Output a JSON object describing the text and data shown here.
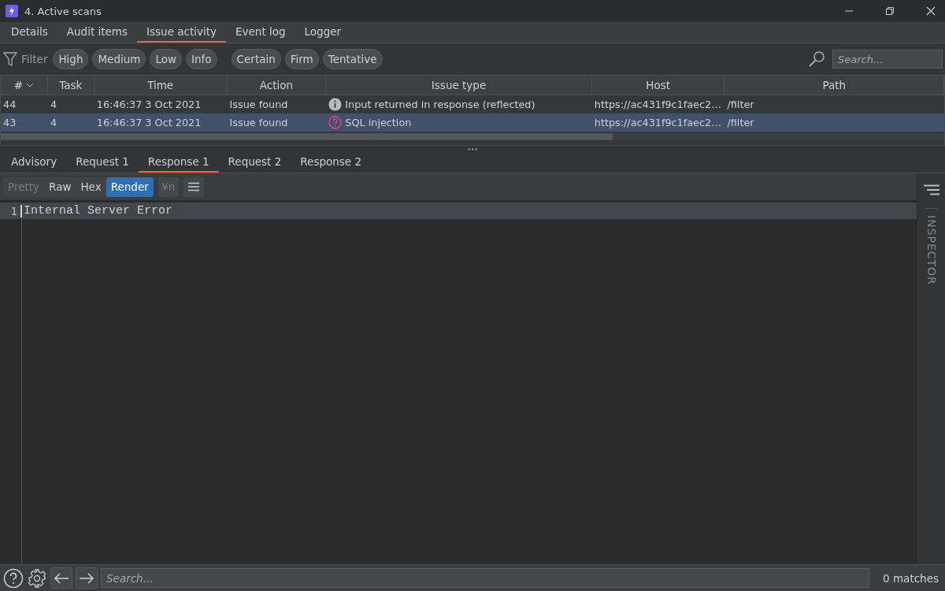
{
  "window": {
    "title": "4. Active scans"
  },
  "tabs": [
    {
      "label": "Details",
      "selected": false
    },
    {
      "label": "Audit items",
      "selected": false
    },
    {
      "label": "Issue activity",
      "selected": true
    },
    {
      "label": "Event log",
      "selected": false
    },
    {
      "label": "Logger",
      "selected": false
    }
  ],
  "filter": {
    "label": "Filter",
    "severity": [
      "High",
      "Medium",
      "Low",
      "Info"
    ],
    "confidence": [
      "Certain",
      "Firm",
      "Tentative"
    ],
    "search": {
      "placeholder": "Search..."
    }
  },
  "table": {
    "columns": [
      "#",
      "Task",
      "Time",
      "Action",
      "Issue type",
      "Host",
      "Path"
    ],
    "rows": [
      {
        "cells": [
          "44",
          "4",
          "16:46:37 3 Oct 2021",
          "Issue found",
          "Input returned in response (reflected)",
          "https://ac431f9c1faec2…",
          "/filter"
        ],
        "kind": "info",
        "selected": false
      },
      {
        "cells": [
          "43",
          "4",
          "16:46:37 3 Oct 2021",
          "Issue found",
          "SQL injection",
          "https://ac431f9c1faec2…",
          "/filter"
        ],
        "kind": "question",
        "selected": true
      }
    ]
  },
  "detail_tabs": [
    {
      "label": "Advisory",
      "selected": false
    },
    {
      "label": "Request 1",
      "selected": false
    },
    {
      "label": "Response 1",
      "selected": true
    },
    {
      "label": "Request 2",
      "selected": false
    },
    {
      "label": "Response 2",
      "selected": false
    }
  ],
  "view_buttons": [
    {
      "label": "Pretty",
      "selected": false,
      "disabled": true
    },
    {
      "label": "Raw",
      "selected": false,
      "disabled": false
    },
    {
      "label": "Hex",
      "selected": false,
      "disabled": false
    },
    {
      "label": "Render",
      "selected": true,
      "disabled": false
    }
  ],
  "newline_button": {
    "label": "¥n",
    "disabled": true
  },
  "editor": {
    "lines": [
      {
        "number": "1",
        "text": "Internal Server Error"
      }
    ]
  },
  "inspector": {
    "label": "INSPECTOR"
  },
  "bottom": {
    "search": {
      "placeholder": "Search..."
    },
    "matches": "0 matches"
  }
}
